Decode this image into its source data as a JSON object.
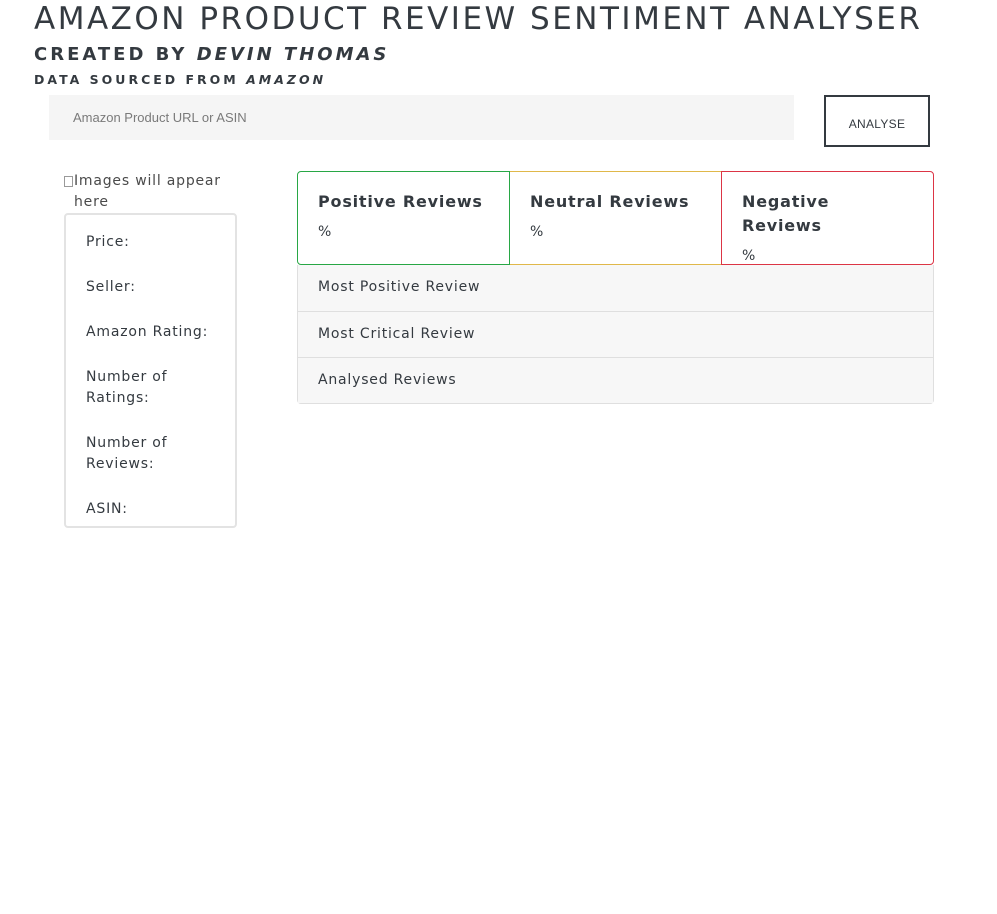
{
  "header": {
    "title": "AMAZON PRODUCT REVIEW SENTIMENT ANALYSER",
    "created_by_prefix": "CREATED BY",
    "author": "DEVIN THOMAS",
    "source_prefix": "DATA SOURCED FROM",
    "source": "AMAZON"
  },
  "search": {
    "placeholder": "Amazon Product URL or ASIN",
    "button_label": "ANALYSE"
  },
  "product": {
    "image_alt": "Images will appear here",
    "fields": {
      "price": "Price:",
      "seller": "Seller:",
      "rating": "Amazon Rating:",
      "num_ratings": "Number of Ratings:",
      "num_reviews": "Number of Reviews:",
      "asin": "ASIN:"
    }
  },
  "sentiment": {
    "positive": {
      "title": "Positive Reviews",
      "value": "%"
    },
    "neutral": {
      "title": "Neutral Reviews",
      "value": "%"
    },
    "negative": {
      "title": "Negative Reviews",
      "value": "%"
    },
    "colors": {
      "positive": "#28a745",
      "neutral": "#e0b84a",
      "negative": "#dc3545"
    }
  },
  "accordion": {
    "most_positive": "Most Positive Review",
    "most_critical": "Most Critical Review",
    "analysed": "Analysed Reviews"
  }
}
